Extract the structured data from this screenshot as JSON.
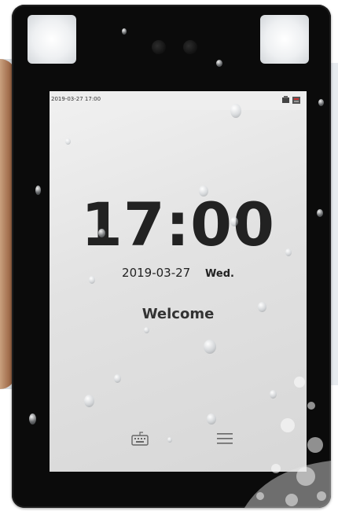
{
  "status_bar": {
    "datetime": "2019-03-27 17:00",
    "icons": [
      "usb-icon",
      "network-icon"
    ]
  },
  "clock": {
    "time": "17:00",
    "date": "2019-03-27",
    "weekday": "Wed."
  },
  "message": "Welcome",
  "bottom_buttons": [
    {
      "name": "keyboard-icon"
    },
    {
      "name": "menu-icon"
    }
  ],
  "colors": {
    "device_frame": "#0b0b0b",
    "screen_background": "#e4e4e4",
    "text": "#222222"
  }
}
